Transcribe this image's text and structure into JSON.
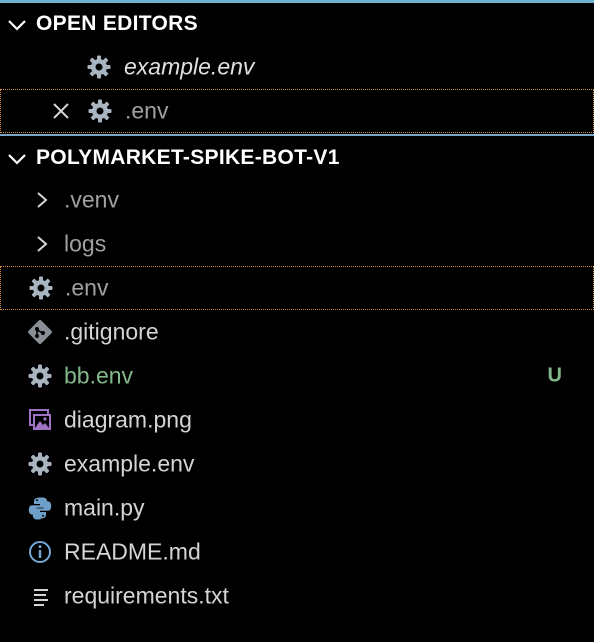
{
  "open_editors": {
    "title": "OPEN EDITORS",
    "items": [
      {
        "label": "example.env",
        "icon": "gear-icon",
        "italic": true
      },
      {
        "label": ".env",
        "icon": "gear-icon",
        "italic": false,
        "close_icon": "close-icon"
      }
    ]
  },
  "folder": {
    "title": "POLYMARKET-SPIKE-BOT-V1",
    "items": [
      {
        "label": ".venv",
        "type": "folder"
      },
      {
        "label": "logs",
        "type": "folder"
      },
      {
        "label": ".env",
        "icon": "gear-icon"
      },
      {
        "label": ".gitignore",
        "icon": "git-icon"
      },
      {
        "label": "bb.env",
        "icon": "gear-icon",
        "badge": "U"
      },
      {
        "label": "diagram.png",
        "icon": "image-icon"
      },
      {
        "label": "example.env",
        "icon": "gear-icon"
      },
      {
        "label": "main.py",
        "icon": "python-icon"
      },
      {
        "label": "README.md",
        "icon": "info-icon"
      },
      {
        "label": "requirements.txt",
        "icon": "lines-icon"
      }
    ]
  },
  "colors": {
    "accent": "#6fb3d2",
    "focus_border": "#d38a3a",
    "untracked": "#81b88b"
  }
}
